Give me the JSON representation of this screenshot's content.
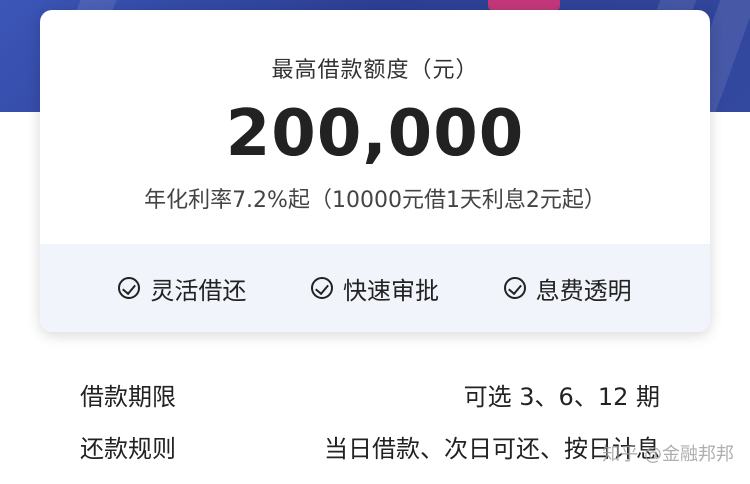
{
  "card": {
    "title": "最高借款额度（元）",
    "amount": "200,000",
    "rate_text": "年化利率7.2%起（10000元借1天利息2元起）"
  },
  "features": [
    {
      "label": "灵活借还",
      "icon": "check-circle-icon"
    },
    {
      "label": "快速审批",
      "icon": "check-circle-icon"
    },
    {
      "label": "息费透明",
      "icon": "check-circle-icon"
    }
  ],
  "info": [
    {
      "label": "借款期限",
      "value": "可选 3、6、12 期"
    },
    {
      "label": "还款规则",
      "value": "当日借款、次日可还、按日计息"
    }
  ],
  "watermark": "知乎 @金融邦邦",
  "colors": {
    "hero": "#2c3f93",
    "accent_pink": "#c2387a",
    "feature_bg": "#f1f4fa"
  }
}
